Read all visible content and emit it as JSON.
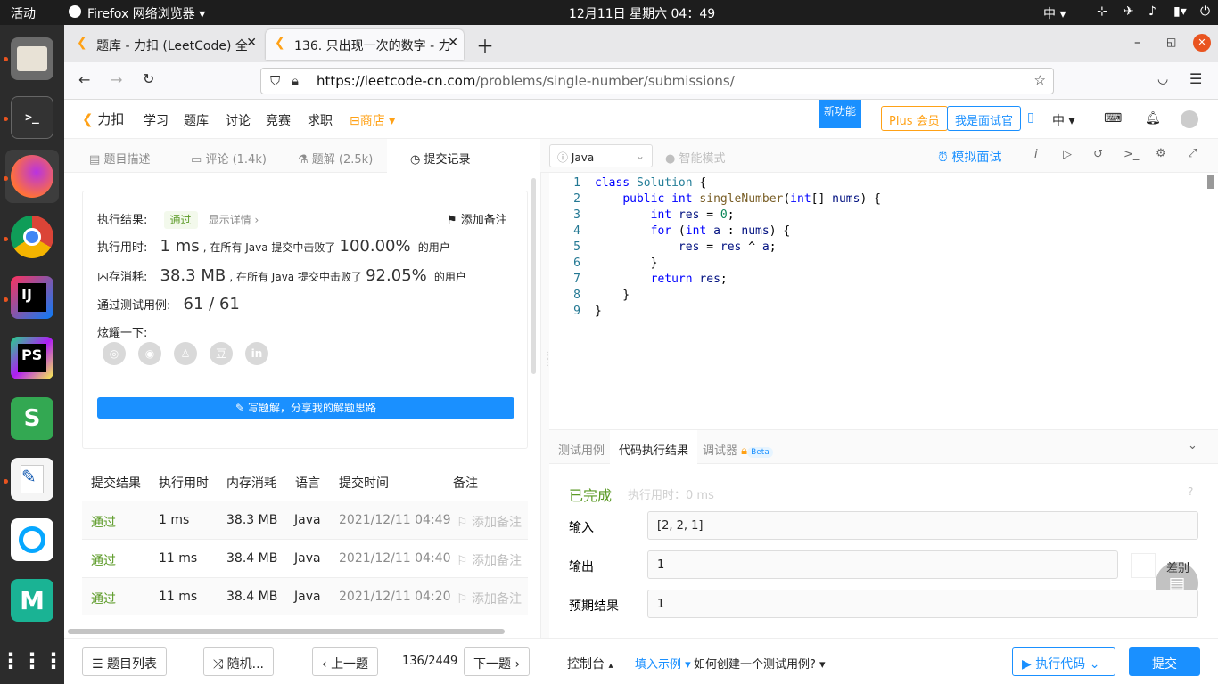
{
  "os": {
    "activities": "活动",
    "app_menu": "Firefox 网络浏览器",
    "datetime": "12月11日 星期六  04：49",
    "input_method": "中"
  },
  "browser": {
    "tabs": [
      {
        "title": "题库 - 力扣 (LeetCode) 全"
      },
      {
        "title": "136. 只出现一次的数字 - 力"
      }
    ],
    "url_domain": "https://leetcode-cn.com",
    "url_path": "/problems/single-number/submissions/"
  },
  "site_nav": {
    "logo": "力扣",
    "items": [
      "学习",
      "题库",
      "讨论",
      "竞赛",
      "求职"
    ],
    "shop": "商店",
    "new_feature": "新功能",
    "plus": "Plus 会员",
    "interviewer": "我是面试官",
    "lang": "中"
  },
  "left_tabs": {
    "desc": "题目描述",
    "comments": "评论 (1.4k)",
    "solutions": "题解 (2.5k)",
    "submissions": "提交记录"
  },
  "result": {
    "label_status": "执行结果:",
    "status": "通过",
    "details": "显示详情 ›",
    "add_note": "添加备注",
    "label_time": "执行用时:",
    "time": "1 ms",
    "beat_text": ", 在所有 Java 提交中击败了",
    "time_pct": "100.00%",
    "users": "的用户",
    "label_mem": "内存消耗:",
    "mem": "38.3 MB",
    "mem_pct": "92.05%",
    "label_cases": "通过测试用例:",
    "cases": "61 / 61",
    "share_label": "炫耀一下:",
    "share_icons": [
      "wechat-icon",
      "weibo-icon",
      "qq-icon",
      "douban-icon",
      "linkedin-icon"
    ],
    "write_solution": "写题解，分享我的解题思路"
  },
  "table": {
    "headers": [
      "提交结果",
      "执行用时",
      "内存消耗",
      "语言",
      "提交时间",
      "备注"
    ],
    "rows": [
      {
        "result": "通过",
        "time": "1 ms",
        "mem": "38.3 MB",
        "lang": "Java",
        "submitted": "2021/12/11 04:49",
        "note": "添加备注"
      },
      {
        "result": "通过",
        "time": "11 ms",
        "mem": "38.4 MB",
        "lang": "Java",
        "submitted": "2021/12/11 04:40",
        "note": "添加备注"
      },
      {
        "result": "通过",
        "time": "11 ms",
        "mem": "38.4 MB",
        "lang": "Java",
        "submitted": "2021/12/11 04:20",
        "note": "添加备注"
      }
    ]
  },
  "editor": {
    "language": "Java",
    "smart_mode": "智能模式",
    "mock_interview": "模拟面试",
    "line_numbers": [
      "1",
      "2",
      "3",
      "4",
      "5",
      "6",
      "7",
      "8",
      "9"
    ]
  },
  "bottom": {
    "tabs": [
      "测试用例",
      "代码执行结果",
      "调试器"
    ],
    "beta": "Beta",
    "done": "已完成",
    "exec_time": "执行用时：0 ms",
    "input_label": "输入",
    "input_value": "[2, 2, 1]",
    "output_label": "输出",
    "output_value": "1",
    "diff": "差别",
    "expected_label": "预期结果",
    "expected_value": "1"
  },
  "footer": {
    "problem_list": "题目列表",
    "random": "随机...",
    "prev": "上一题",
    "counter": "136/2449",
    "next": "下一题",
    "console": "控制台",
    "fill_example": "填入示例",
    "how_create": "如何创建一个测试用例?",
    "run_code": "执行代码",
    "submit": "提交"
  },
  "colors": {
    "accent": "#1a90ff",
    "pass": "#5b9a26",
    "shop": "#ffa116",
    "firefox_dock_highlight": "#3d3d3d"
  }
}
